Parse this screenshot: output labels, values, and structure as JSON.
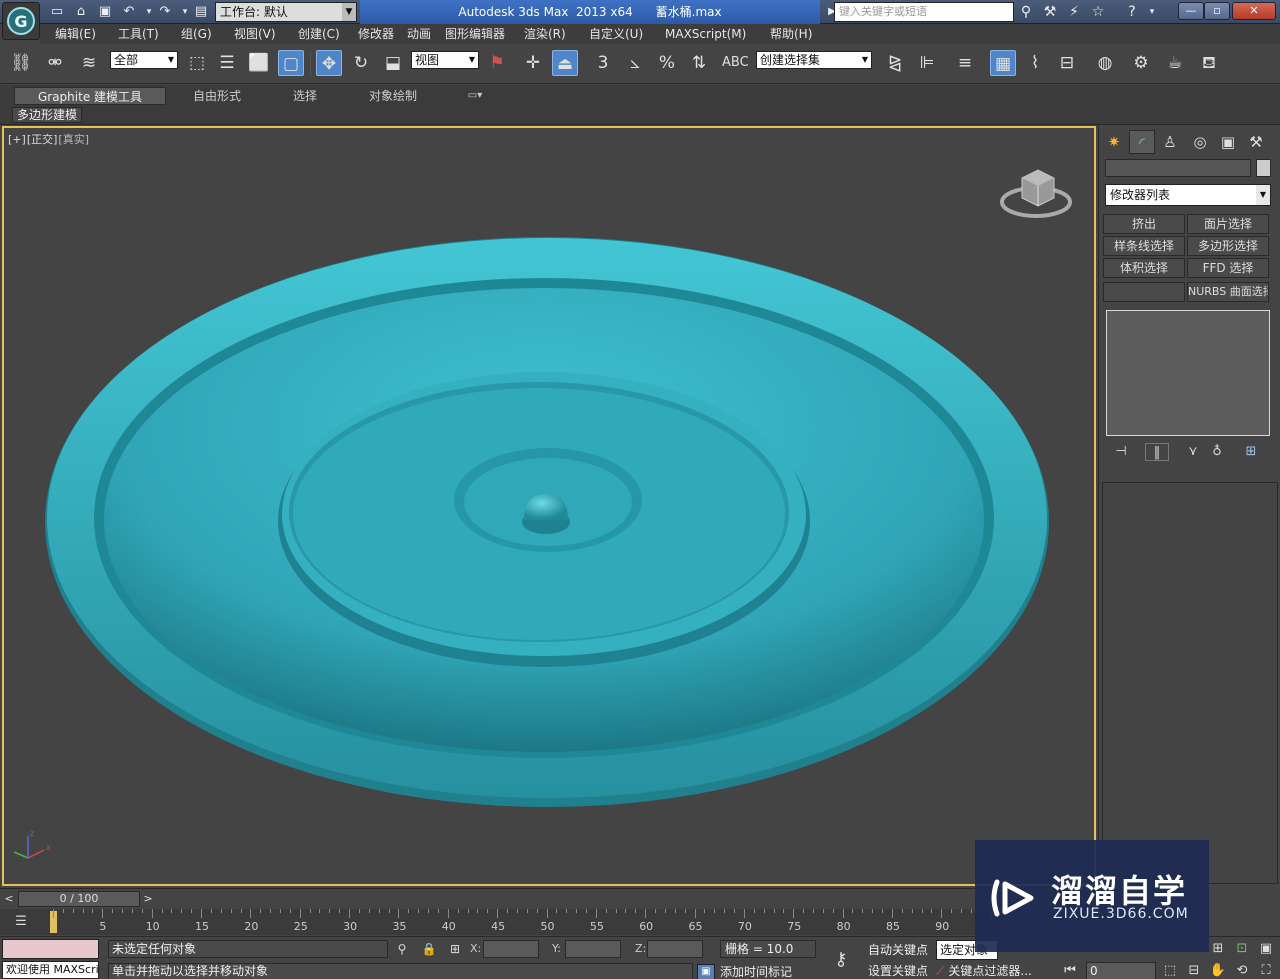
{
  "titlebar": {
    "workspace_label": "工作台: 默认",
    "app_title": "Autodesk 3ds Max  2013 x64      蓄水桶.max",
    "search_placeholder": "键入关键字或短语"
  },
  "menu": [
    "编辑(E)",
    "工具(T)",
    "组(G)",
    "视图(V)",
    "创建(C)",
    "修改器",
    "动画",
    "图形编辑器",
    "渲染(R)",
    "自定义(U)",
    "MAXScript(M)",
    "帮助(H)"
  ],
  "toolbar": {
    "selection_filter": "全部",
    "ref_coord": "视图",
    "named_selection": "创建选择集",
    "snap_3": "3",
    "snap_percent": "%"
  },
  "ribbon": {
    "tabs": [
      "Graphite 建模工具",
      "自由形式",
      "选择",
      "对象绘制"
    ],
    "sub_tab": "多边形建模"
  },
  "viewport": {
    "label_plus": "[+]",
    "label_view": "[正交]",
    "label_shading": "[真实]",
    "model_color": "#2fa5b6",
    "border_color": "#e3c25a"
  },
  "command_panel": {
    "modifier_list": "修改器列表",
    "buttons": [
      "挤出",
      "面片选择",
      "样条线选择",
      "多边形选择",
      "体积选择",
      "FFD 选择",
      "",
      "NURBS 曲面选择"
    ]
  },
  "timeslider": {
    "position": "0 / 100",
    "left_arrow": "<",
    "right_arrow": ">",
    "ticks": [
      "0",
      "5",
      "10",
      "15",
      "20",
      "25",
      "30",
      "35",
      "40",
      "45",
      "50",
      "55",
      "60",
      "65",
      "70",
      "75",
      "80",
      "85",
      "90"
    ]
  },
  "status": {
    "maxscript_welcome": "欢迎使用 MAXScri",
    "selection": "未选定任何对象",
    "prompt": "单击并拖动以选择并移动对象",
    "x_label": "X:",
    "y_label": "Y:",
    "z_label": "Z:",
    "grid": "栅格 = 10.0",
    "add_time_tag": "添加时间标记",
    "auto_key": "自动关键点",
    "set_key": "设置关键点",
    "selected_dd": "选定对象",
    "key_filters": "关键点过滤器...",
    "frame": "0"
  },
  "watermark": {
    "title": "溜溜自学",
    "url": "ZIXUE.3D66.COM"
  }
}
